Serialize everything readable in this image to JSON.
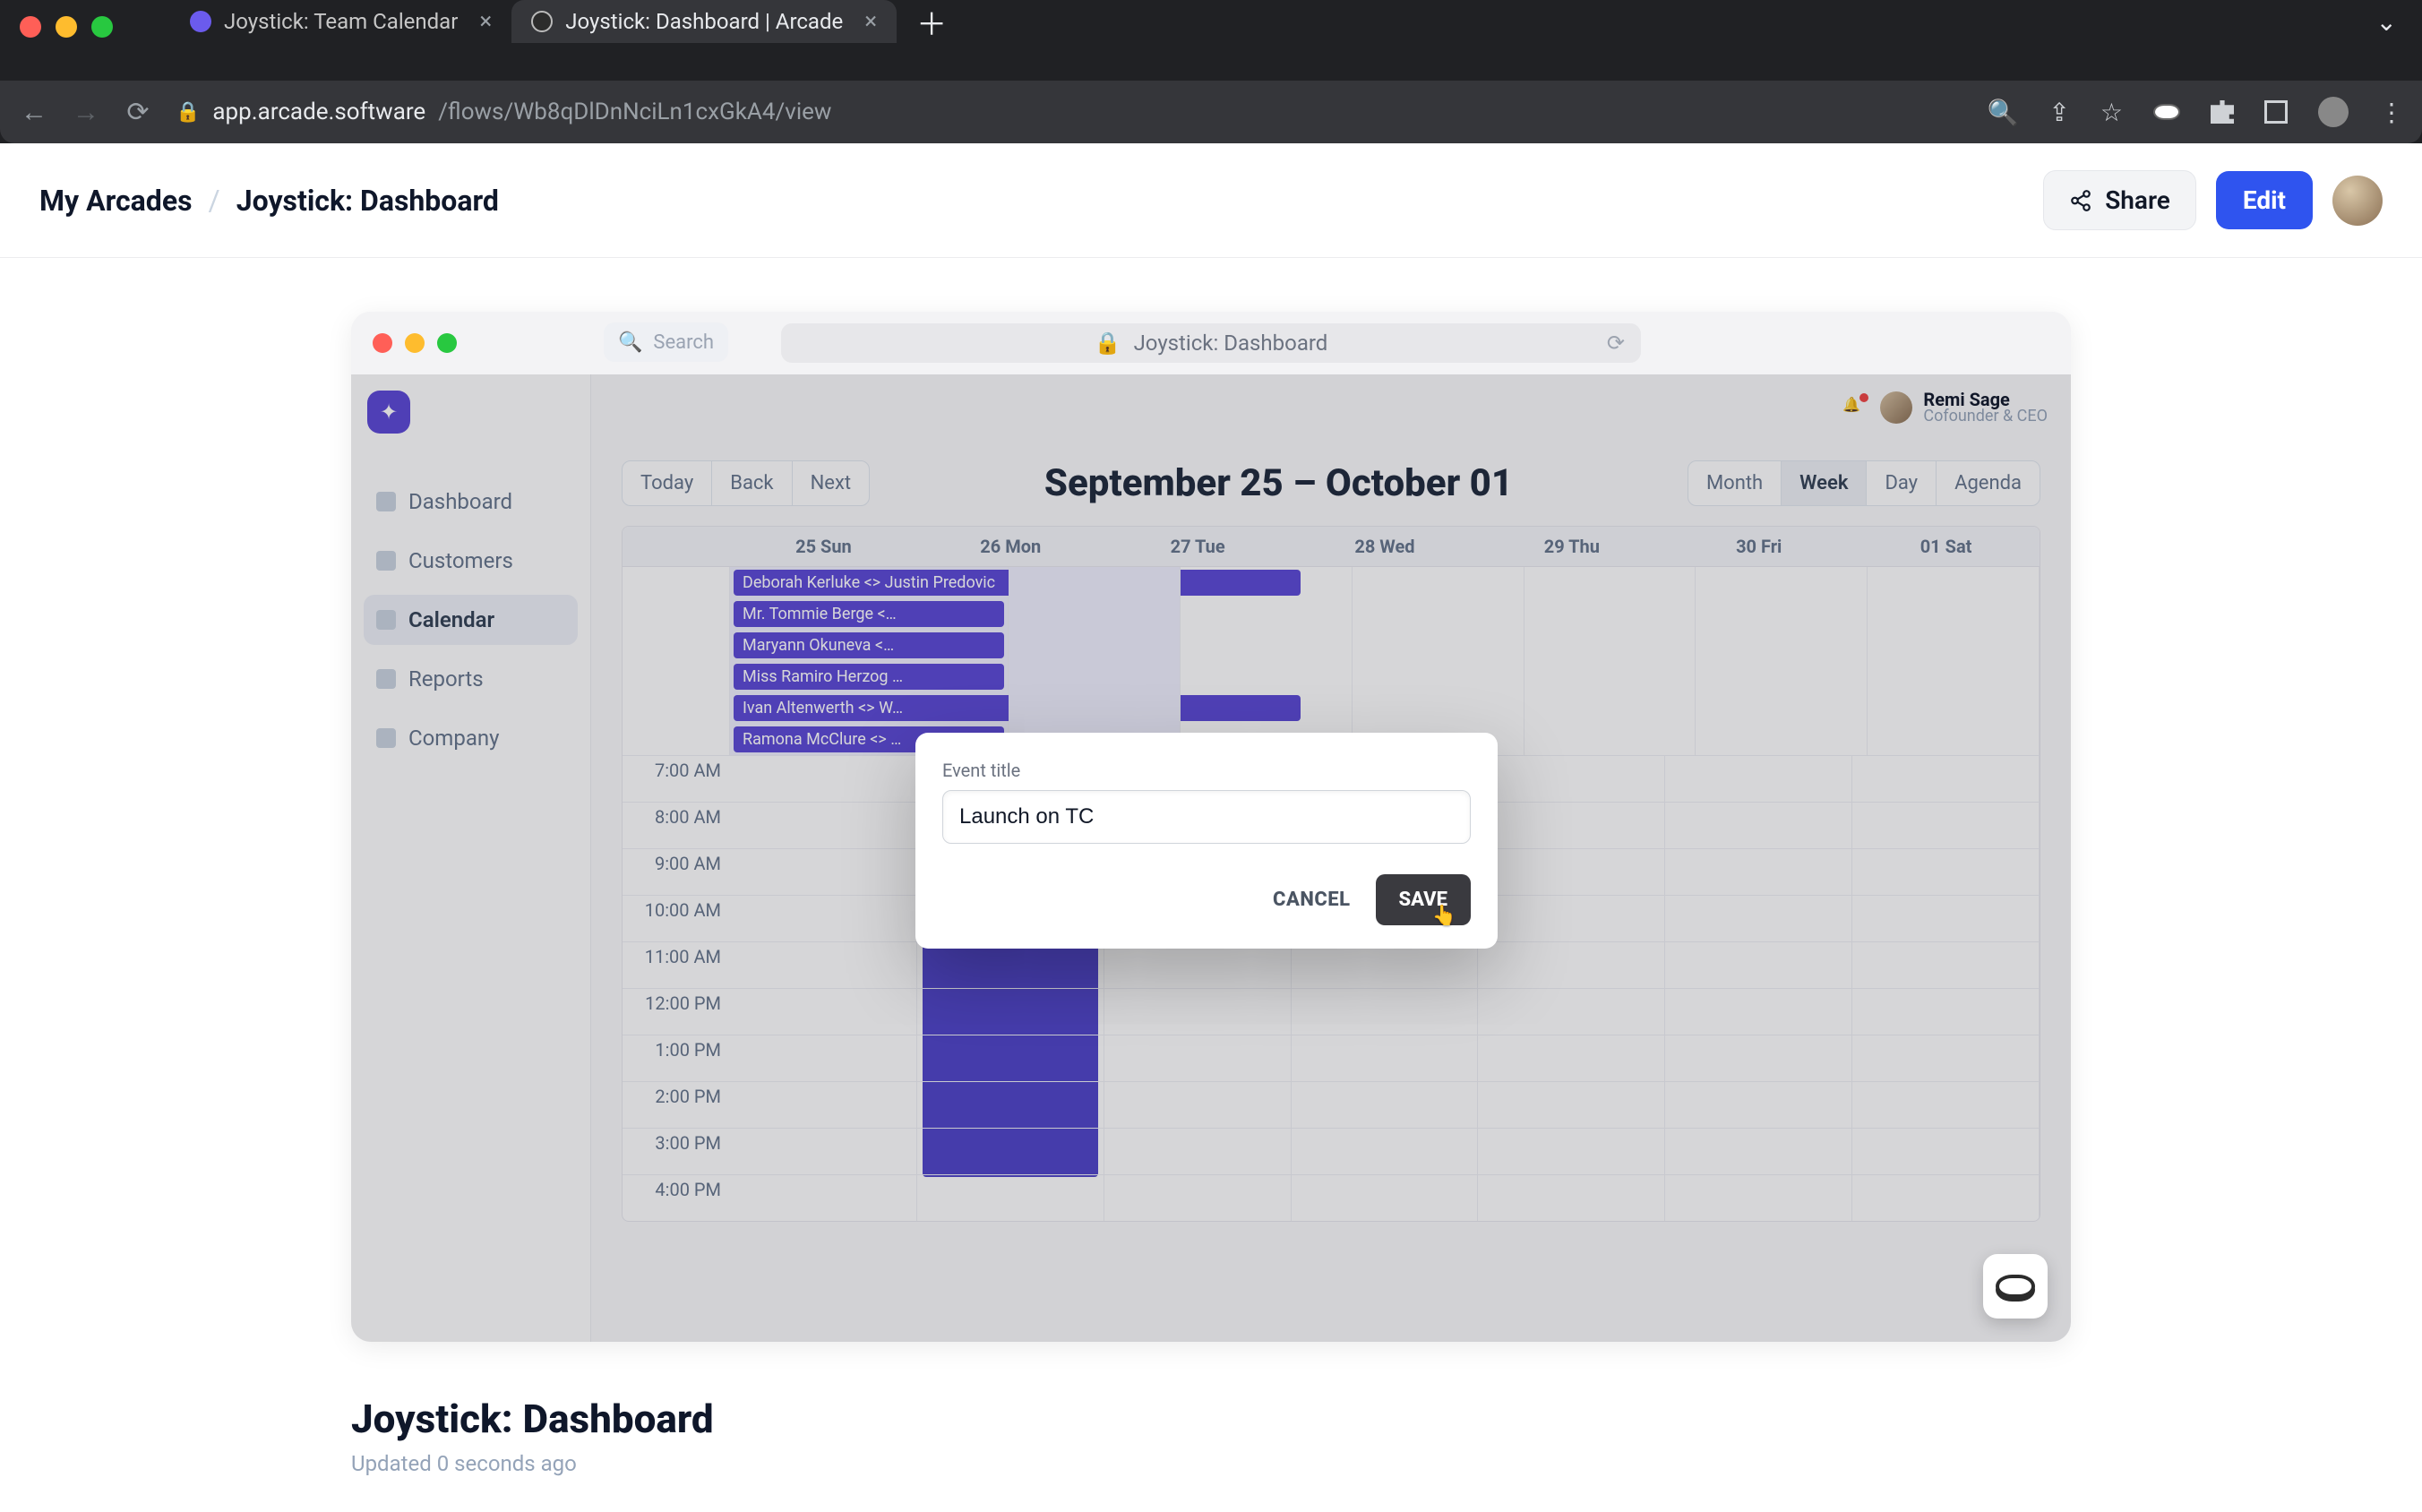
{
  "browser": {
    "tabs": [
      {
        "title": "Joystick: Team Calendar",
        "fav_color": "#6b5bed"
      },
      {
        "title": "Joystick: Dashboard | Arcade",
        "fav_color": "#ffffff"
      }
    ],
    "url_host": "app.arcade.software",
    "url_path": "/flows/Wb8qDlDnNciLn1cxGkA4/view"
  },
  "header": {
    "crumb_root": "My Arcades",
    "crumb_page": "Joystick: Dashboard",
    "share_label": "Share",
    "edit_label": "Edit"
  },
  "preview_bar": {
    "title": "Joystick: Dashboard"
  },
  "app": {
    "search_placeholder": "Search",
    "sidebar": {
      "items": [
        {
          "label": "Dashboard"
        },
        {
          "label": "Customers"
        },
        {
          "label": "Calendar"
        },
        {
          "label": "Reports"
        },
        {
          "label": "Company"
        }
      ]
    },
    "user": {
      "name": "Remi Sage",
      "role": "Cofounder & CEO"
    },
    "calendar": {
      "nav": {
        "today": "Today",
        "back": "Back",
        "next": "Next"
      },
      "range_title": "September 25 – October 01",
      "views": {
        "month": "Month",
        "week": "Week",
        "day": "Day",
        "agenda": "Agenda"
      },
      "days": [
        "25 Sun",
        "26 Mon",
        "27 Tue",
        "28 Wed",
        "29 Thu",
        "30 Fri",
        "01 Sat"
      ],
      "allday_events": [
        "Deborah Kerluke <> Justin Predovic",
        "Mr. Tommie Berge <…",
        "Maryann Okuneva <…",
        "Miss Ramiro Herzog …",
        "Ivan Altenwerth <> W…",
        "Ramona McClure <> …"
      ],
      "hours": [
        "7:00 AM",
        "8:00 AM",
        "9:00 AM",
        "10:00 AM",
        "11:00 AM",
        "12:00 PM",
        "1:00 PM",
        "2:00 PM",
        "3:00 PM",
        "4:00 PM"
      ]
    }
  },
  "modal": {
    "label": "Event title",
    "value": "Launch on TC",
    "cancel_label": "CANCEL",
    "save_label": "SAVE"
  },
  "below": {
    "title": "Joystick: Dashboard",
    "subtitle": "Updated 0 seconds ago"
  }
}
